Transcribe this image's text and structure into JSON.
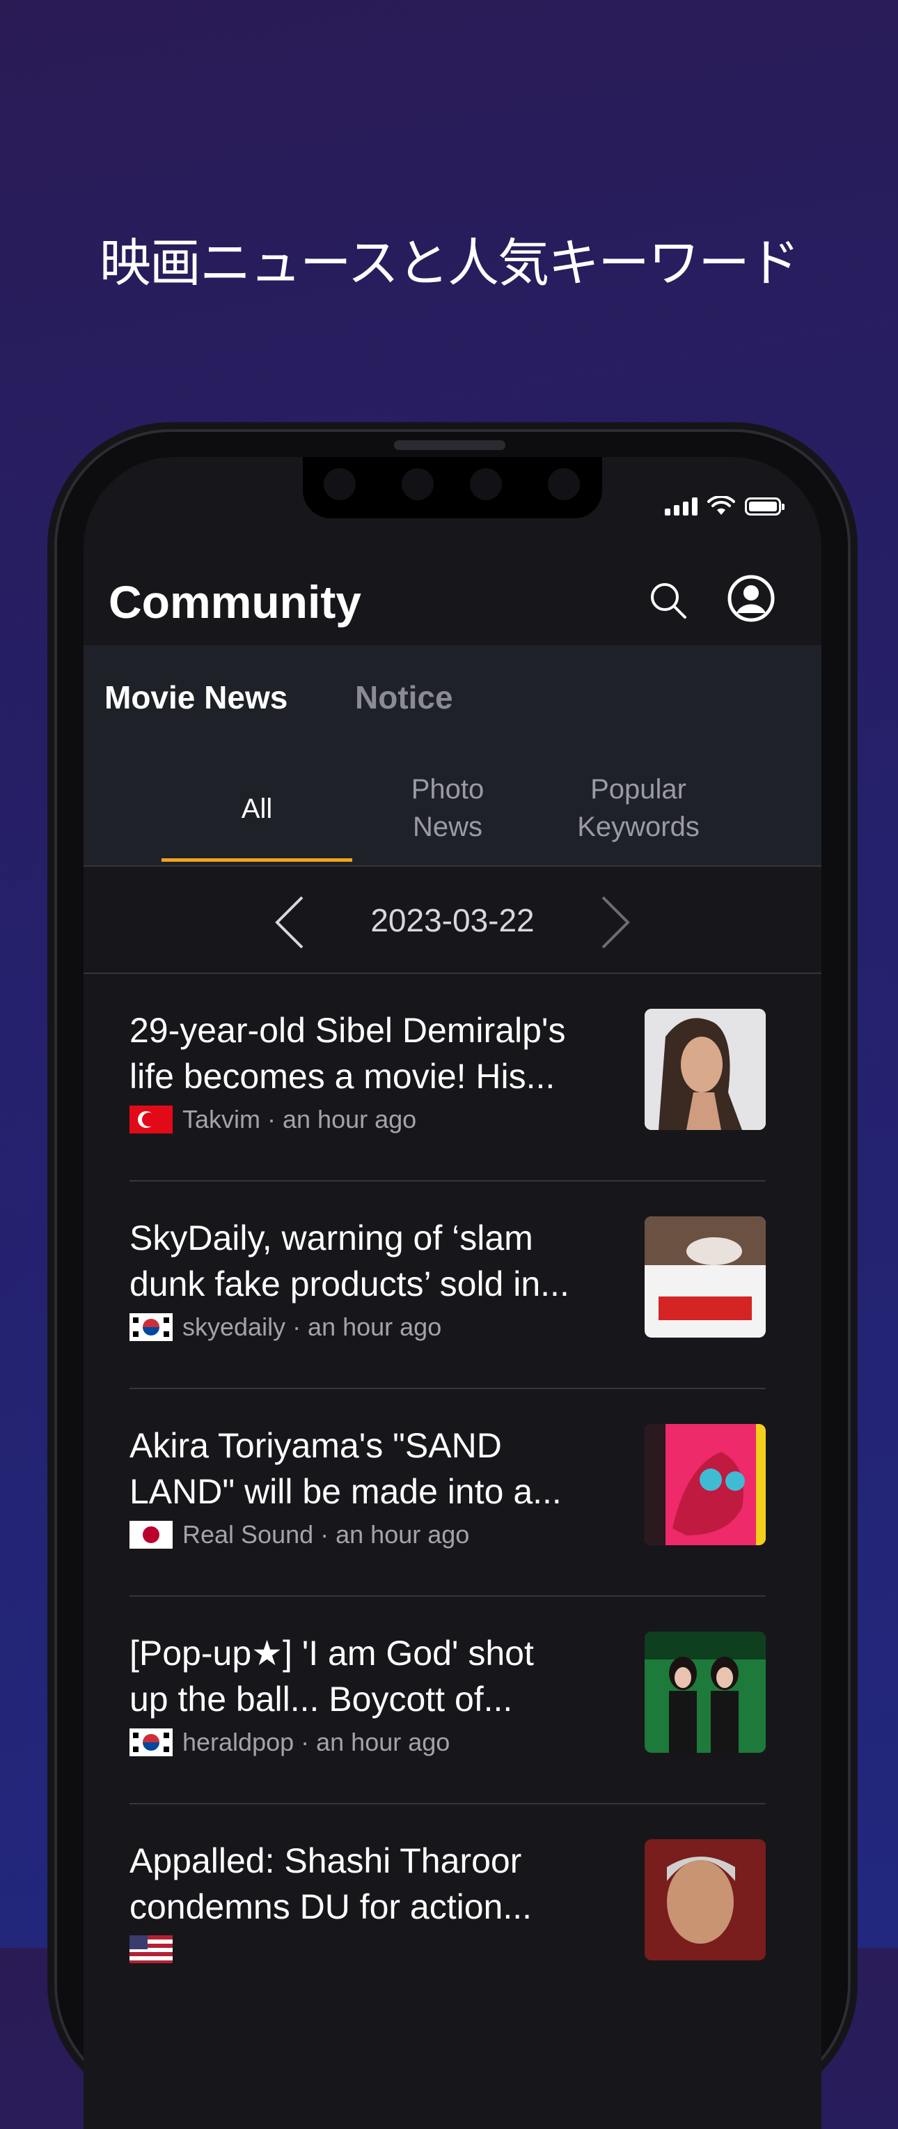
{
  "promo": {
    "headline": "映画ニュースと人気キーワード"
  },
  "app": {
    "title": "Community",
    "main_tabs": [
      {
        "label": "Movie News",
        "active": true
      },
      {
        "label": "Notice",
        "active": false
      }
    ],
    "sub_tabs": [
      {
        "line1": "All",
        "line2": "",
        "active": true
      },
      {
        "line1": "Photo",
        "line2": "News",
        "active": false
      },
      {
        "line1": "Popular",
        "line2": "Keywords",
        "active": false
      }
    ],
    "date": "2023-03-22",
    "accent_color": "#f0a51e",
    "icons": {
      "search": "search-icon",
      "profile": "profile-icon",
      "prev": "chevron-left-icon",
      "next": "chevron-right-icon"
    }
  },
  "news": [
    {
      "title_line1": "29-year-old Sibel Demiralp's",
      "title_line2": "life becomes a movie! His...",
      "source": "Takvim · an hour ago",
      "flag": "turkey-flag-icon"
    },
    {
      "title_line1": "SkyDaily, warning of ‘slam",
      "title_line2": "dunk fake products’ sold in...",
      "source": "skyedaily · an hour ago",
      "flag": "korea-flag-icon"
    },
    {
      "title_line1": "Akira Toriyama's \"SAND",
      "title_line2": "LAND\" will be made into a...",
      "source": "Real Sound · an hour ago",
      "flag": "japan-flag-icon"
    },
    {
      "title_line1": "[Pop-up★] 'I am God' shot",
      "title_line2": "up the ball... Boycott of...",
      "source": "heraldpop · an hour ago",
      "flag": "korea-flag-icon"
    },
    {
      "title_line1": "Appalled: Shashi Tharoor",
      "title_line2": "condemns DU for action...",
      "source": "",
      "flag": "usa-flag-icon"
    }
  ]
}
